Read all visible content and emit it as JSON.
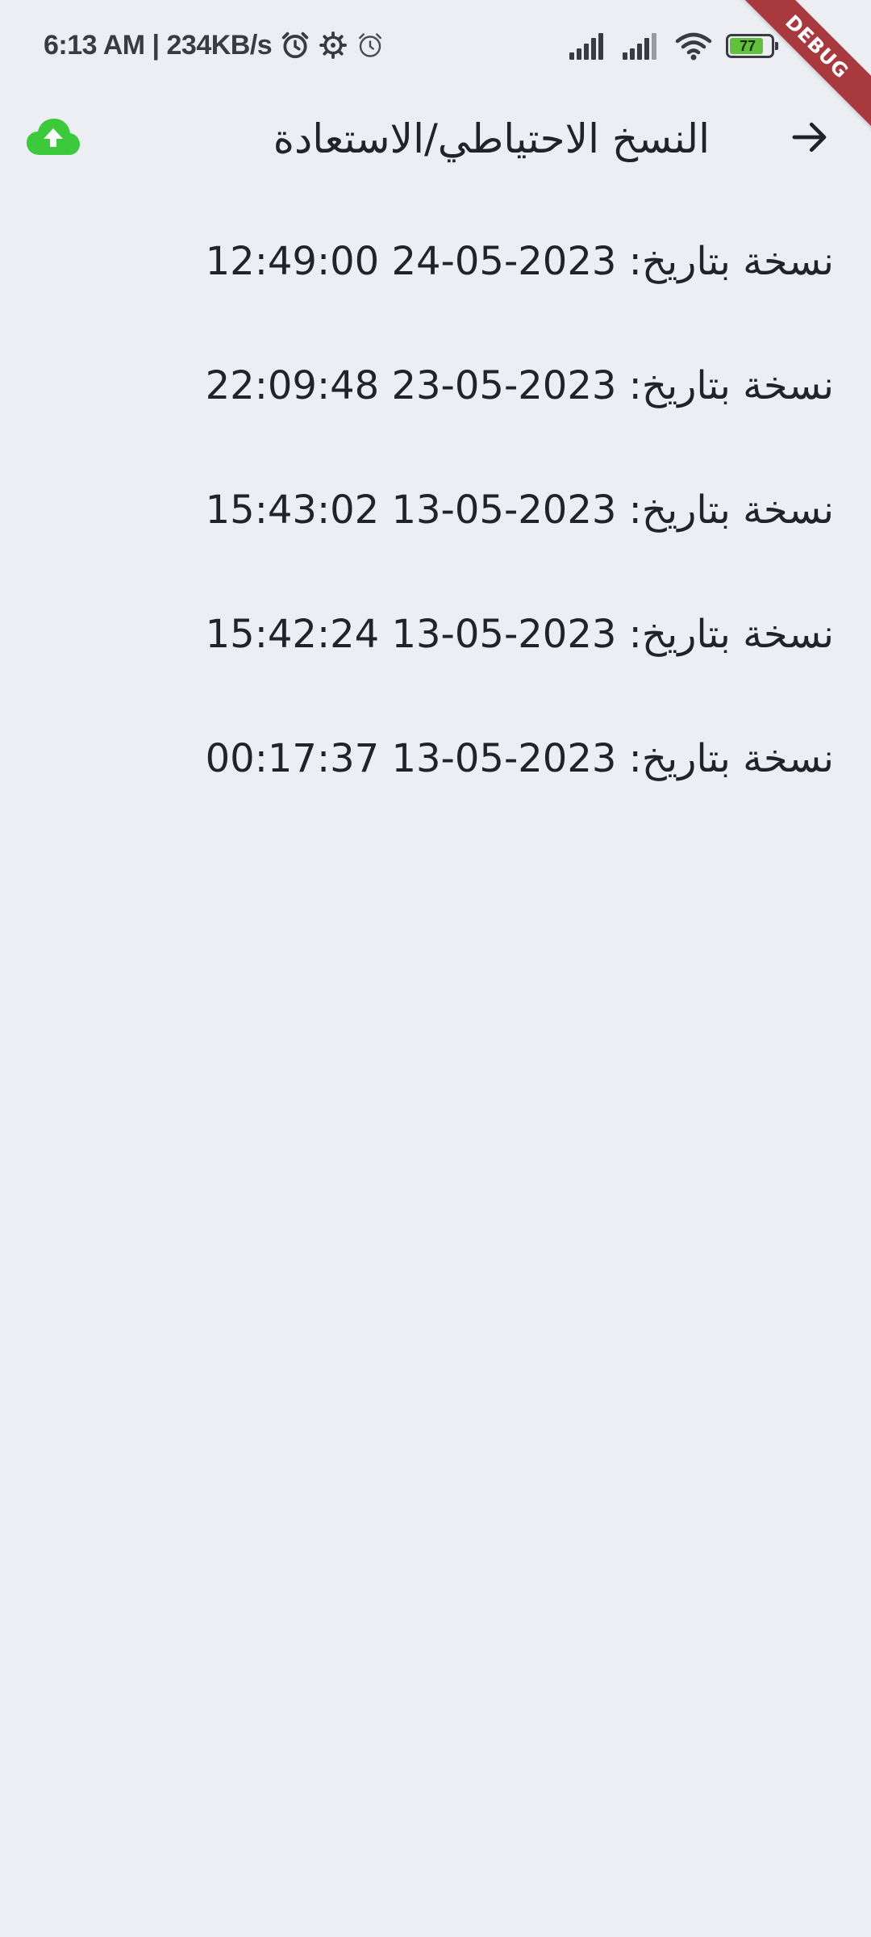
{
  "status_bar": {
    "time_speed": "6:13 AM | 234KB/s",
    "battery_level": "77",
    "icons": [
      "alarm-icon",
      "gear-icon",
      "alarm-outline-icon",
      "signal-icon",
      "signal-icon",
      "wifi-icon",
      "battery-icon"
    ]
  },
  "debug_banner": "DEBUG",
  "app_bar": {
    "title": "النسخ الاحتياطي/الاستعادة",
    "upload_icon": "cloud-upload-icon",
    "back_icon": "arrow-right-icon"
  },
  "backups": [
    {
      "label": "نسخة بتاريخ: 2023-05-24 12:49:00"
    },
    {
      "label": "نسخة بتاريخ: 2023-05-23 22:09:48"
    },
    {
      "label": "نسخة بتاريخ: 2023-05-13 15:43:02"
    },
    {
      "label": "نسخة بتاريخ: 2023-05-13 15:42:24"
    },
    {
      "label": "نسخة بتاريخ: 2023-05-13 00:17:37"
    }
  ],
  "colors": {
    "background": "#eceef3",
    "text": "#22232a",
    "cloud": "#3cc93c",
    "debug": "#a83a3f",
    "battery_fill": "#62c13c"
  }
}
